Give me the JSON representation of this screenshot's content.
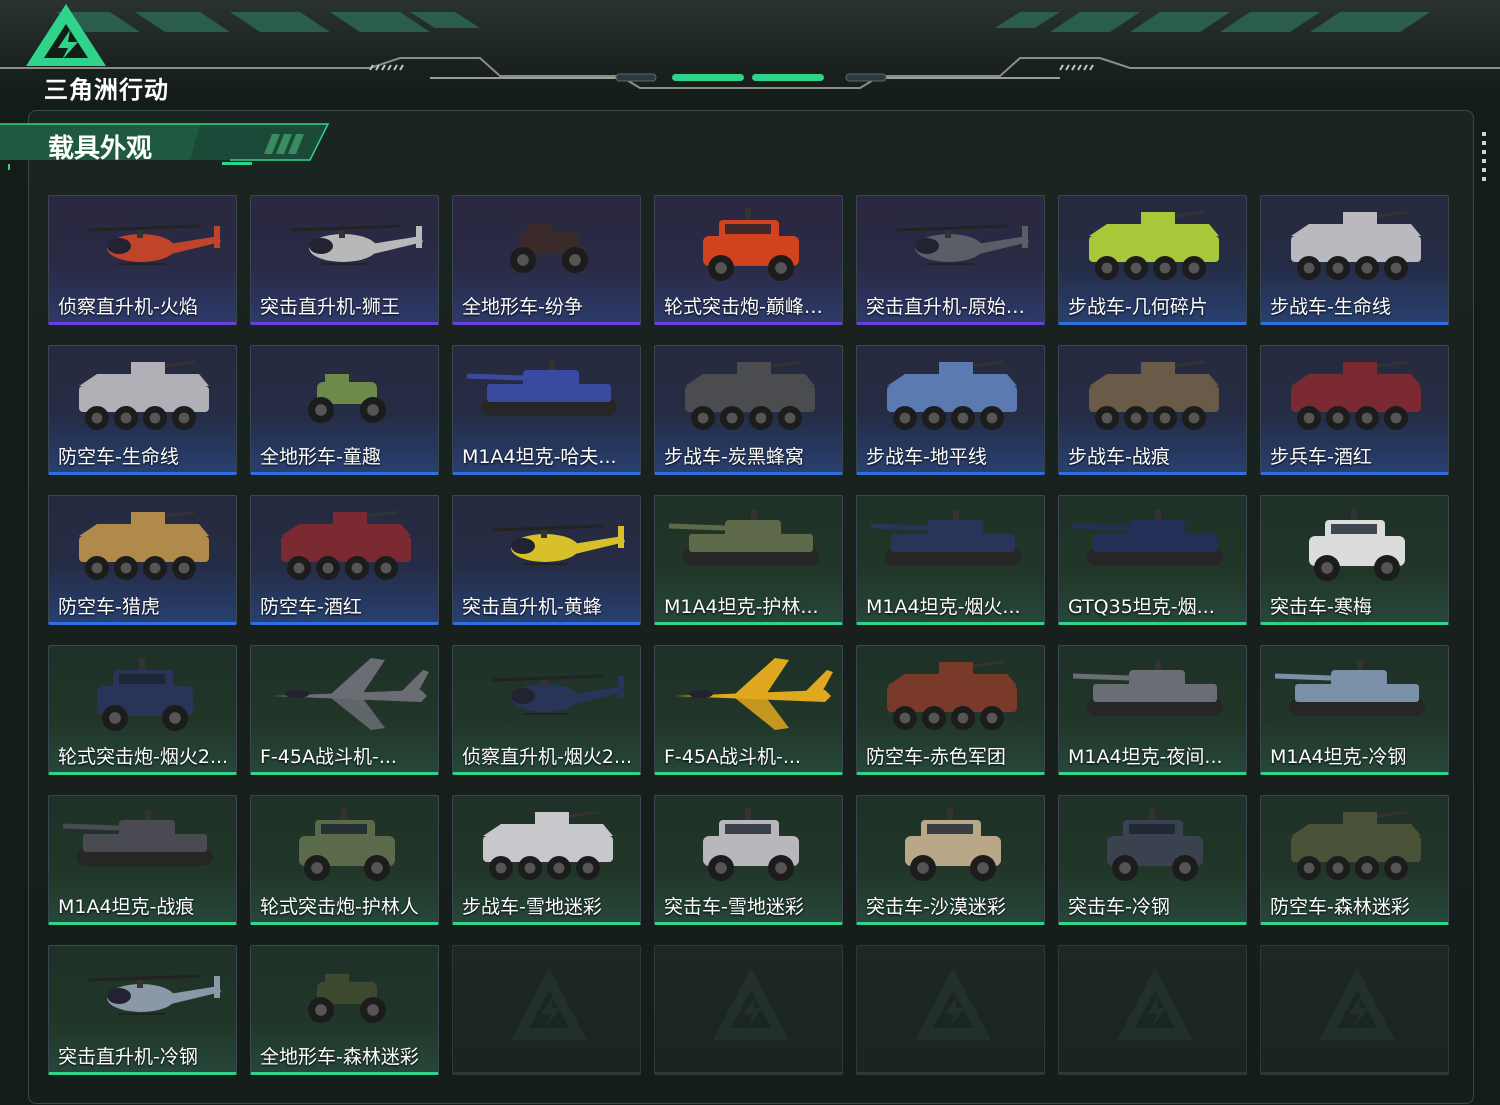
{
  "app": {
    "logo_text": "三角洲行动",
    "logo": "triangle-lightning-logo"
  },
  "section": {
    "title": "载具外观"
  },
  "colors": {
    "purple": "#6a3fe0",
    "blue": "#2f6fe0",
    "green": "#2fd48a",
    "empty": "#7b8380"
  },
  "vehicles": [
    {
      "name": "侦察直升机-火焰",
      "tier": "purple",
      "kind": "heli",
      "paint": "#c0442a"
    },
    {
      "name": "突击直升机-狮王",
      "tier": "purple",
      "kind": "heli",
      "paint": "#b8b8b8"
    },
    {
      "name": "全地形车-纷争",
      "tier": "purple",
      "kind": "atv",
      "paint": "#3a2a2a"
    },
    {
      "name": "轮式突击炮-巅峰竞...",
      "tier": "purple",
      "kind": "truck",
      "paint": "#d2421e"
    },
    {
      "name": "突击直升机-原始伪...",
      "tier": "purple",
      "kind": "heli",
      "paint": "#5a5e66"
    },
    {
      "name": "步战车-几何碎片",
      "tier": "blue",
      "kind": "ifv",
      "paint": "#a8c83a"
    },
    {
      "name": "步战车-生命线",
      "tier": "blue",
      "kind": "ifv",
      "paint": "#b9b9bf"
    },
    {
      "name": "防空车-生命线",
      "tier": "blue",
      "kind": "ifv",
      "paint": "#b0b0b6"
    },
    {
      "name": "全地形车-童趣",
      "tier": "blue",
      "kind": "atv",
      "paint": "#6e8a4a"
    },
    {
      "name": "M1A4坦克-哈夫...",
      "tier": "blue",
      "kind": "tank",
      "paint": "#3a4aa0"
    },
    {
      "name": "步战车-炭黑蜂窝",
      "tier": "blue",
      "kind": "ifv",
      "paint": "#4a4c50"
    },
    {
      "name": "步战车-地平线",
      "tier": "blue",
      "kind": "ifv",
      "paint": "#5a7ab0"
    },
    {
      "name": "步战车-战痕",
      "tier": "blue",
      "kind": "ifv",
      "paint": "#6a5a48"
    },
    {
      "name": "步兵车-酒红",
      "tier": "blue",
      "kind": "ifv",
      "paint": "#7a2a30"
    },
    {
      "name": "防空车-猎虎",
      "tier": "blue",
      "kind": "ifv",
      "paint": "#b08a4a"
    },
    {
      "name": "防空车-酒红",
      "tier": "blue",
      "kind": "ifv",
      "paint": "#7a2a30"
    },
    {
      "name": "突击直升机-黄蜂",
      "tier": "blue",
      "kind": "heli",
      "paint": "#d8c02a"
    },
    {
      "name": "M1A4坦克-护林...",
      "tier": "green",
      "kind": "tank",
      "paint": "#5e6a4a"
    },
    {
      "name": "M1A4坦克-烟火...",
      "tier": "green",
      "kind": "tank",
      "paint": "#2a3458"
    },
    {
      "name": "GTQ35坦克-烟...",
      "tier": "green",
      "kind": "tank",
      "paint": "#243058"
    },
    {
      "name": "突击车-寒梅",
      "tier": "green",
      "kind": "truck",
      "paint": "#dcdcdc"
    },
    {
      "name": "轮式突击炮-烟火2...",
      "tier": "green",
      "kind": "truck",
      "paint": "#2a3458"
    },
    {
      "name": "F-45A战斗机-...",
      "tier": "green",
      "kind": "jet",
      "paint": "#6a6e74"
    },
    {
      "name": "侦察直升机-烟火2...",
      "tier": "green",
      "kind": "heli",
      "paint": "#2a3458"
    },
    {
      "name": "F-45A战斗机-...",
      "tier": "green",
      "kind": "jet",
      "paint": "#e0a81e"
    },
    {
      "name": "防空车-赤色军团",
      "tier": "green",
      "kind": "ifv",
      "paint": "#7a3a2a"
    },
    {
      "name": "M1A4坦克-夜间...",
      "tier": "green",
      "kind": "tank",
      "paint": "#6a6e74"
    },
    {
      "name": "M1A4坦克-冷钢",
      "tier": "green",
      "kind": "tank",
      "paint": "#7a90a8"
    },
    {
      "name": "M1A4坦克-战痕",
      "tier": "green",
      "kind": "tank",
      "paint": "#4a4a52"
    },
    {
      "name": "轮式突击炮-护林人",
      "tier": "green",
      "kind": "truck",
      "paint": "#5a6a4a"
    },
    {
      "name": "步战车-雪地迷彩",
      "tier": "green",
      "kind": "ifv",
      "paint": "#c8c8cc"
    },
    {
      "name": "突击车-雪地迷彩",
      "tier": "green",
      "kind": "truck",
      "paint": "#b8b8bc"
    },
    {
      "name": "突击车-沙漠迷彩",
      "tier": "green",
      "kind": "truck",
      "paint": "#b8a888"
    },
    {
      "name": "突击车-冷钢",
      "tier": "green",
      "kind": "truck",
      "paint": "#3a4250"
    },
    {
      "name": "防空车-森林迷彩",
      "tier": "green",
      "kind": "ifv",
      "paint": "#4a5238"
    },
    {
      "name": "突击直升机-冷钢",
      "tier": "green",
      "kind": "heli",
      "paint": "#8a98a8"
    },
    {
      "name": "全地形车-森林迷彩",
      "tier": "green",
      "kind": "atv",
      "paint": "#3e4a30"
    },
    {
      "name": "",
      "tier": "empty",
      "kind": "empty",
      "paint": ""
    },
    {
      "name": "",
      "tier": "empty",
      "kind": "empty",
      "paint": ""
    },
    {
      "name": "",
      "tier": "empty",
      "kind": "empty",
      "paint": ""
    },
    {
      "name": "",
      "tier": "empty",
      "kind": "empty",
      "paint": ""
    },
    {
      "name": "",
      "tier": "empty",
      "kind": "empty",
      "paint": ""
    }
  ]
}
